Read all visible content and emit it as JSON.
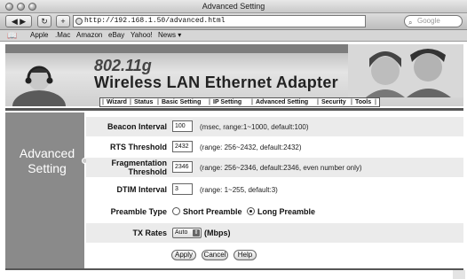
{
  "window": {
    "title": "Advanced Setting"
  },
  "toolbar": {
    "url": "http://192.168.1.50/advanced.html",
    "search_placeholder": "Google",
    "back_icon": "back-arrow-icon",
    "forward_icon": "forward-arrow-icon",
    "reload_icon": "reload-icon",
    "add_icon": "plus-icon"
  },
  "bookmarks": [
    "Apple",
    ".Mac",
    "Amazon",
    "eBay",
    "Yahoo!",
    "News ▾"
  ],
  "banner": {
    "model": "802.11g",
    "product": "Wireless LAN Ethernet Adapter"
  },
  "nav": [
    "Wizard",
    "Status",
    "Basic Setting",
    "IP Setting",
    "Advanced Setting",
    "Security",
    "Tools"
  ],
  "sidebar": {
    "title": "Advanced Setting"
  },
  "form": {
    "beacon": {
      "label": "Beacon Interval",
      "value": "100",
      "hint": "(msec, range:1~1000, default:100)"
    },
    "rts": {
      "label": "RTS Threshold",
      "value": "2432",
      "hint": "(range: 256~2432, default:2432)"
    },
    "frag": {
      "label_line1": "Fragmentation",
      "label_line2": "Threshold",
      "value": "2346",
      "hint": "(range: 256~2346, default:2346, even number only)"
    },
    "dtim": {
      "label": "DTIM Interval",
      "value": "3",
      "hint": "(range: 1~255, default:3)"
    },
    "preamble": {
      "label": "Preamble Type",
      "short": "Short Preamble",
      "long": "Long Preamble",
      "selected": "long"
    },
    "tx": {
      "label": "TX Rates",
      "value": "Auto",
      "unit": "(Mbps)"
    }
  },
  "buttons": {
    "apply": "Apply",
    "cancel": "Cancel",
    "help": "Help"
  }
}
